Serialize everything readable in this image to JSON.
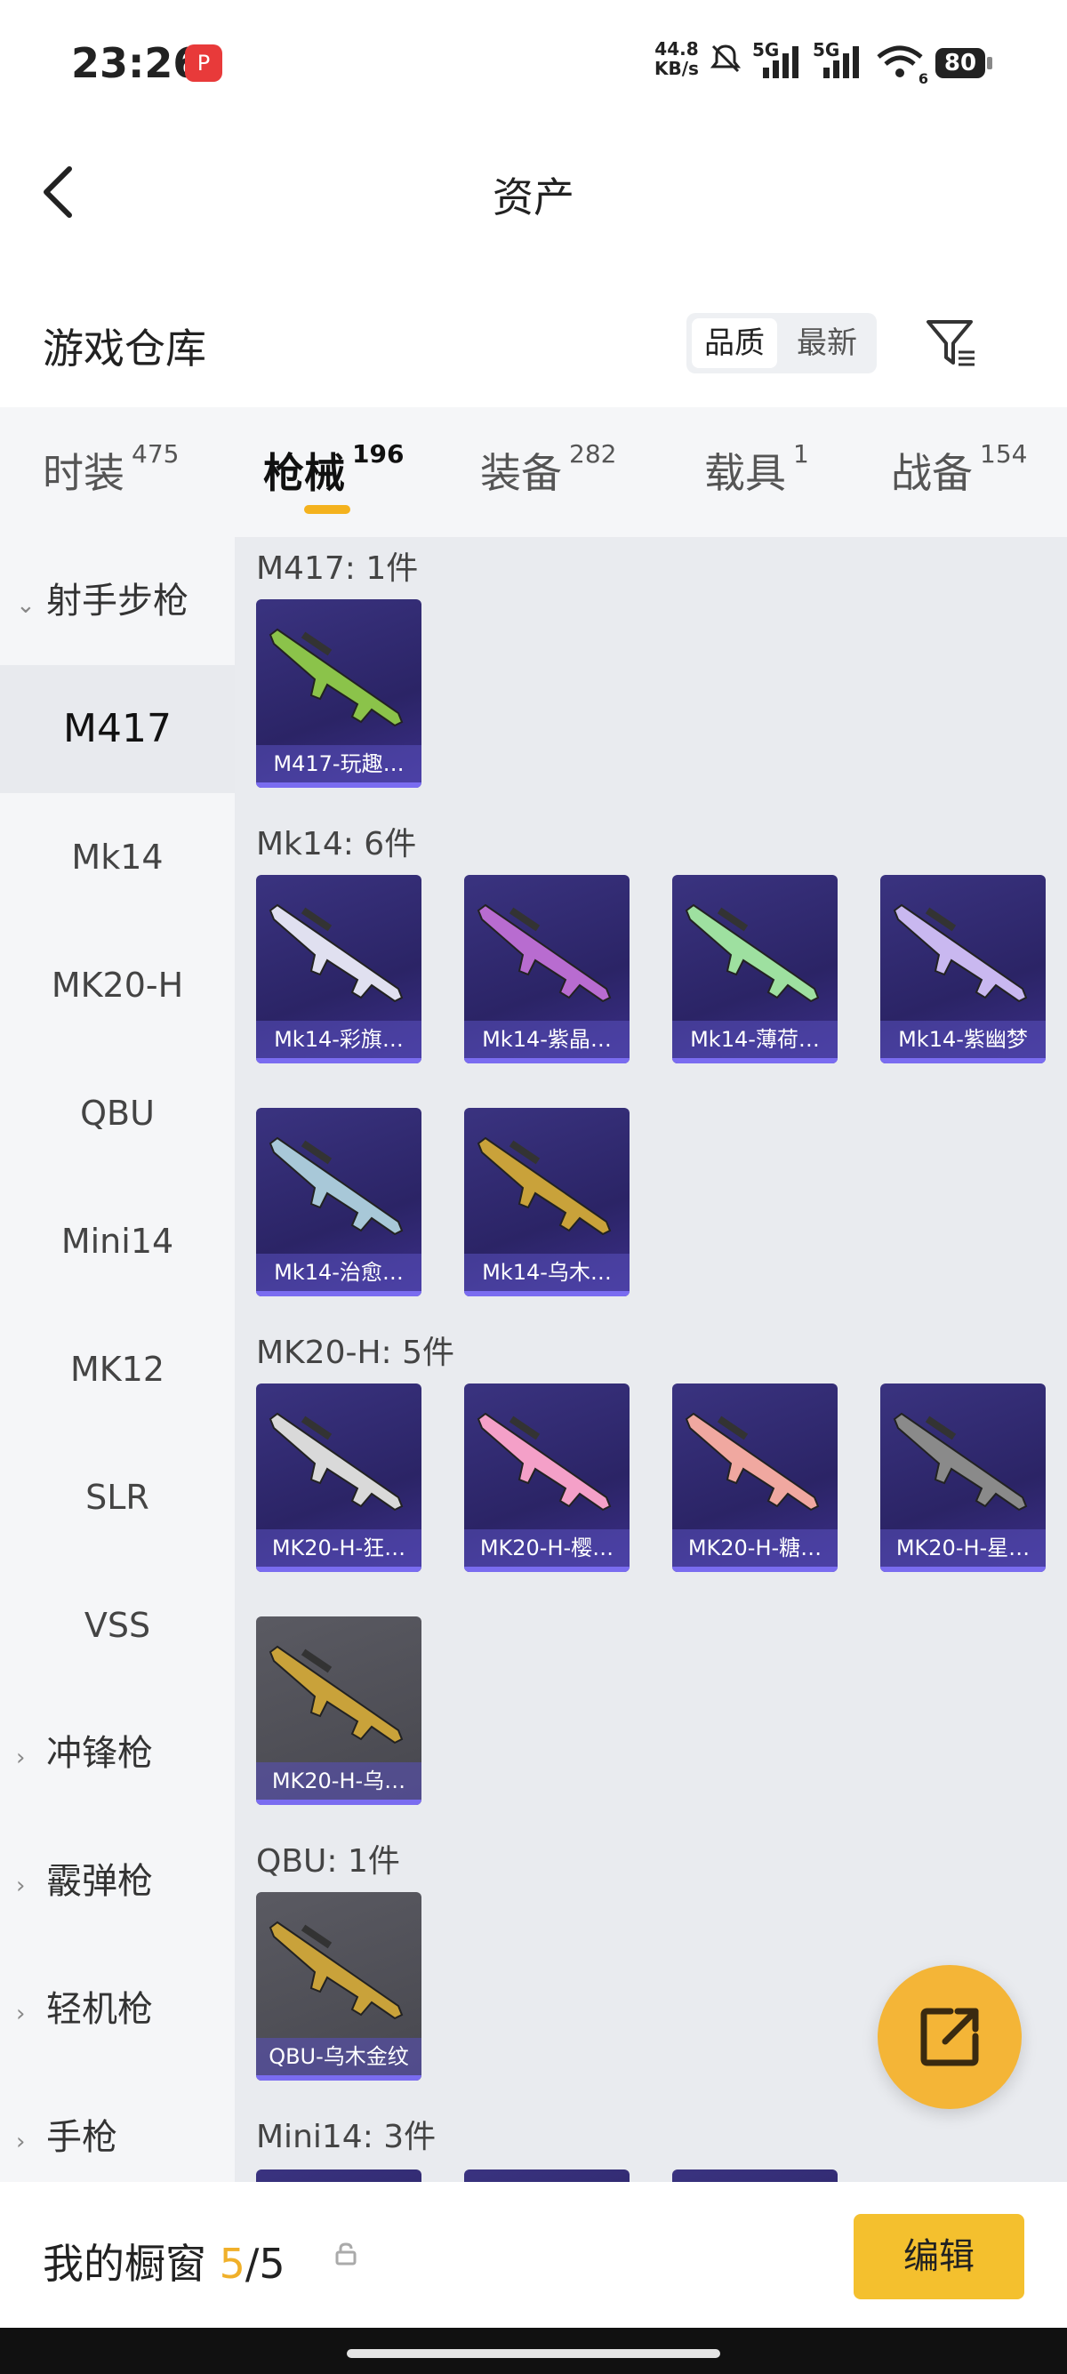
{
  "status_bar": {
    "time": "23:26",
    "net_speed_value": "44.8",
    "net_speed_unit": "KB/s",
    "signal1": "5G",
    "signal2": "5G",
    "wifi_sub": "6",
    "battery": "80"
  },
  "header": {
    "back_icon": "chevron-left-icon",
    "title": "资产"
  },
  "warehouse": {
    "title": "游戏仓库",
    "sort_options": [
      "品质",
      "最新"
    ],
    "active_sort": "品质",
    "filter_icon": "filter-icon"
  },
  "tabs": [
    {
      "label": "时装",
      "count": "475"
    },
    {
      "label": "枪械",
      "count": "196"
    },
    {
      "label": "装备",
      "count": "282"
    },
    {
      "label": "载具",
      "count": "1"
    },
    {
      "label": "战备",
      "count": "154"
    }
  ],
  "active_tab": "枪械",
  "sidebar": {
    "expanded_category": "射手步枪",
    "items": [
      "M417",
      "Mk14",
      "MK20-H",
      "QBU",
      "Mini14",
      "MK12",
      "SLR",
      "VSS"
    ],
    "selected": "M417",
    "collapsed_categories": [
      "冲锋枪",
      "霰弹枪",
      "轻机枪",
      "手枪"
    ]
  },
  "sections": [
    {
      "title": "M417: 1件",
      "items": [
        {
          "name": "M417-玩趣…",
          "color": "#8bc34a"
        }
      ]
    },
    {
      "title": "Mk14: 6件",
      "items": [
        {
          "name": "Mk14-彩旗…",
          "color": "#e0e0f0"
        },
        {
          "name": "Mk14-紫晶…",
          "color": "#b86cd0"
        },
        {
          "name": "Mk14-薄荷…",
          "color": "#9ee0a0"
        },
        {
          "name": "Mk14-紫幽梦",
          "color": "#c9b8f0"
        },
        {
          "name": "Mk14-治愈…",
          "color": "#a8c8d8"
        },
        {
          "name": "Mk14-乌木…",
          "color": "#c9a23a"
        }
      ]
    },
    {
      "title": "MK20-H: 5件",
      "items": [
        {
          "name": "MK20-H-狂…",
          "color": "#d9d9d9"
        },
        {
          "name": "MK20-H-樱…",
          "color": "#f4a0c8"
        },
        {
          "name": "MK20-H-糖…",
          "color": "#f0a8a0"
        },
        {
          "name": "MK20-H-星…",
          "color": "#8a8a8a"
        },
        {
          "name": "MK20-H-乌…",
          "color": "#c9a23a",
          "gray": true
        }
      ]
    },
    {
      "title": "QBU: 1件",
      "items": [
        {
          "name": "QBU-乌木金纹",
          "color": "#c9a23a",
          "gray": true
        }
      ]
    },
    {
      "title": "Mini14: 3件",
      "items": []
    }
  ],
  "fab_icon": "external-link-icon",
  "bottom_bar": {
    "label": "我的橱窗",
    "current": "5",
    "total": "/5",
    "lock_icon": "lock-icon",
    "edit_label": "编辑"
  }
}
